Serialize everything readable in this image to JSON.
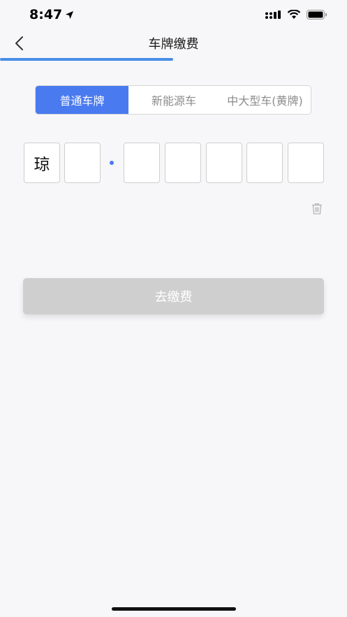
{
  "status_bar": {
    "time": "8:47"
  },
  "nav": {
    "title": "车牌缴费"
  },
  "segments": [
    {
      "label": "普通车牌",
      "active": true
    },
    {
      "label": "新能源车",
      "active": false
    },
    {
      "label": "中大型车(黄牌)",
      "active": false
    }
  ],
  "plate": {
    "cells": [
      "琼",
      "",
      "",
      "",
      "",
      "",
      ""
    ]
  },
  "actions": {
    "pay_label": "去缴费"
  },
  "colors": {
    "accent": "#4a7af0",
    "progress": "#4a8ee8",
    "disabled_button": "#cfcfcf"
  },
  "icons": {
    "back": "chevron-left-icon",
    "delete": "trash-icon"
  }
}
